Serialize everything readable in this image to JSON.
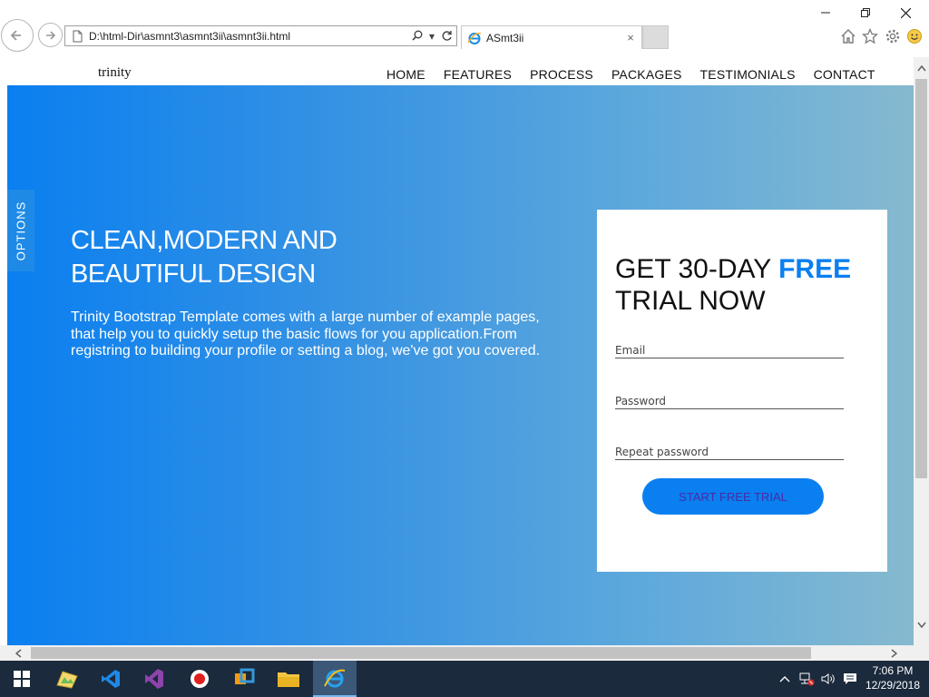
{
  "browser": {
    "url": "D:\\html-Dir\\asmnt3\\asmnt3ii\\asmnt3ii.html",
    "tab_title": "ASmt3ii",
    "tab_close": "×"
  },
  "nav": {
    "brand": "trinity",
    "items": [
      "HOME",
      "FEATURES",
      "PROCESS",
      "PACKAGES",
      "TESTIMONIALS",
      "CONTACT"
    ]
  },
  "hero": {
    "options_label": "OPTIONS",
    "headline_line1": "CLEAN,MODERN AND",
    "headline_line2": "BEAUTIFUL DESIGN",
    "description": "Trinity Bootstrap Template comes with a large number of example pages, that help you to quickly setup the basic flows for you application.From registring to building your profile or setting a blog, we've got you covered."
  },
  "signup": {
    "title_part1": "GET 30-DAY ",
    "title_highlight": "FREE",
    "title_part2": "TRIAL NOW",
    "email_placeholder": "Email",
    "password_placeholder": "Password",
    "repeat_placeholder": "Repeat password",
    "cta_label": "START FREE TRIAL"
  },
  "taskbar": {
    "time": "7:06 PM",
    "date": "12/29/2018"
  },
  "colors": {
    "accent": "#0a7ff0",
    "cta_text": "#4b2aa8",
    "taskbar": "#1b2a3c"
  }
}
